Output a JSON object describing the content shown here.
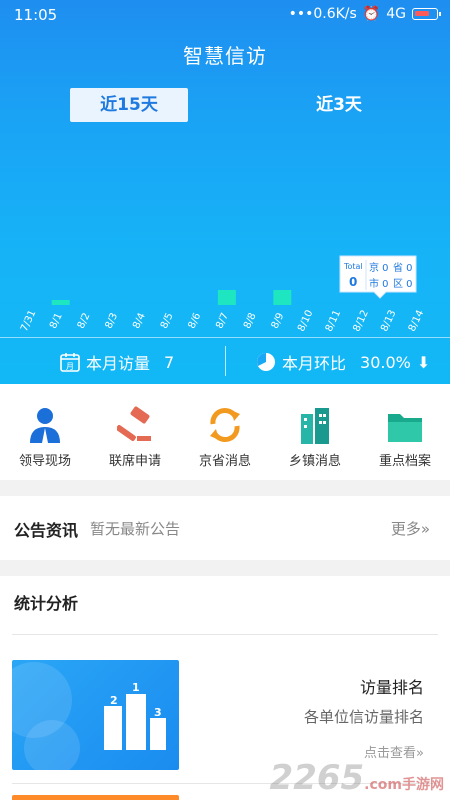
{
  "status": {
    "time": "11:05",
    "network": "•••0.6K/s",
    "signal": "4G"
  },
  "app": {
    "title": "智慧信访"
  },
  "tabs": [
    {
      "label": "近15天"
    },
    {
      "label": "近3天"
    }
  ],
  "tooltip": {
    "total_label": "Total",
    "total_value": "0",
    "jing": "京 0",
    "sheng": "省 0",
    "shi": "市 0",
    "qu": "区 0"
  },
  "chart_data": {
    "type": "bar",
    "categories": [
      "7/31",
      "8/1",
      "8/2",
      "8/3",
      "8/4",
      "8/5",
      "8/6",
      "8/7",
      "8/8",
      "8/9",
      "8/10",
      "8/11",
      "8/12",
      "8/13",
      "8/14"
    ],
    "values": [
      0,
      1,
      0,
      0,
      0,
      0,
      0,
      3,
      0,
      3,
      0,
      0,
      0,
      0,
      0
    ],
    "ylim": [
      0,
      20
    ],
    "colors": {
      "bar": "#1de6c0"
    }
  },
  "summary": {
    "month_visits_label": "本月访量",
    "month_visits_value": "7",
    "ratio_label": "本月环比",
    "ratio_value": "30.0%"
  },
  "shortcuts": [
    {
      "label": "领导现场",
      "icon": "leader-icon"
    },
    {
      "label": "联席申请",
      "icon": "gavel-icon"
    },
    {
      "label": "京省消息",
      "icon": "refresh-icon"
    },
    {
      "label": "乡镇消息",
      "icon": "building-icon"
    },
    {
      "label": "重点档案",
      "icon": "folder-icon"
    }
  ],
  "notice": {
    "title": "公告资讯",
    "desc": "暂无最新公告",
    "more": "更多»"
  },
  "stats": {
    "title": "统计分析",
    "rank_title": "访量排名",
    "rank_desc": "各单位信访量排名",
    "rank_link": "点击查看»"
  },
  "watermark": {
    "text": "2265",
    "sub": ".com手游网"
  }
}
